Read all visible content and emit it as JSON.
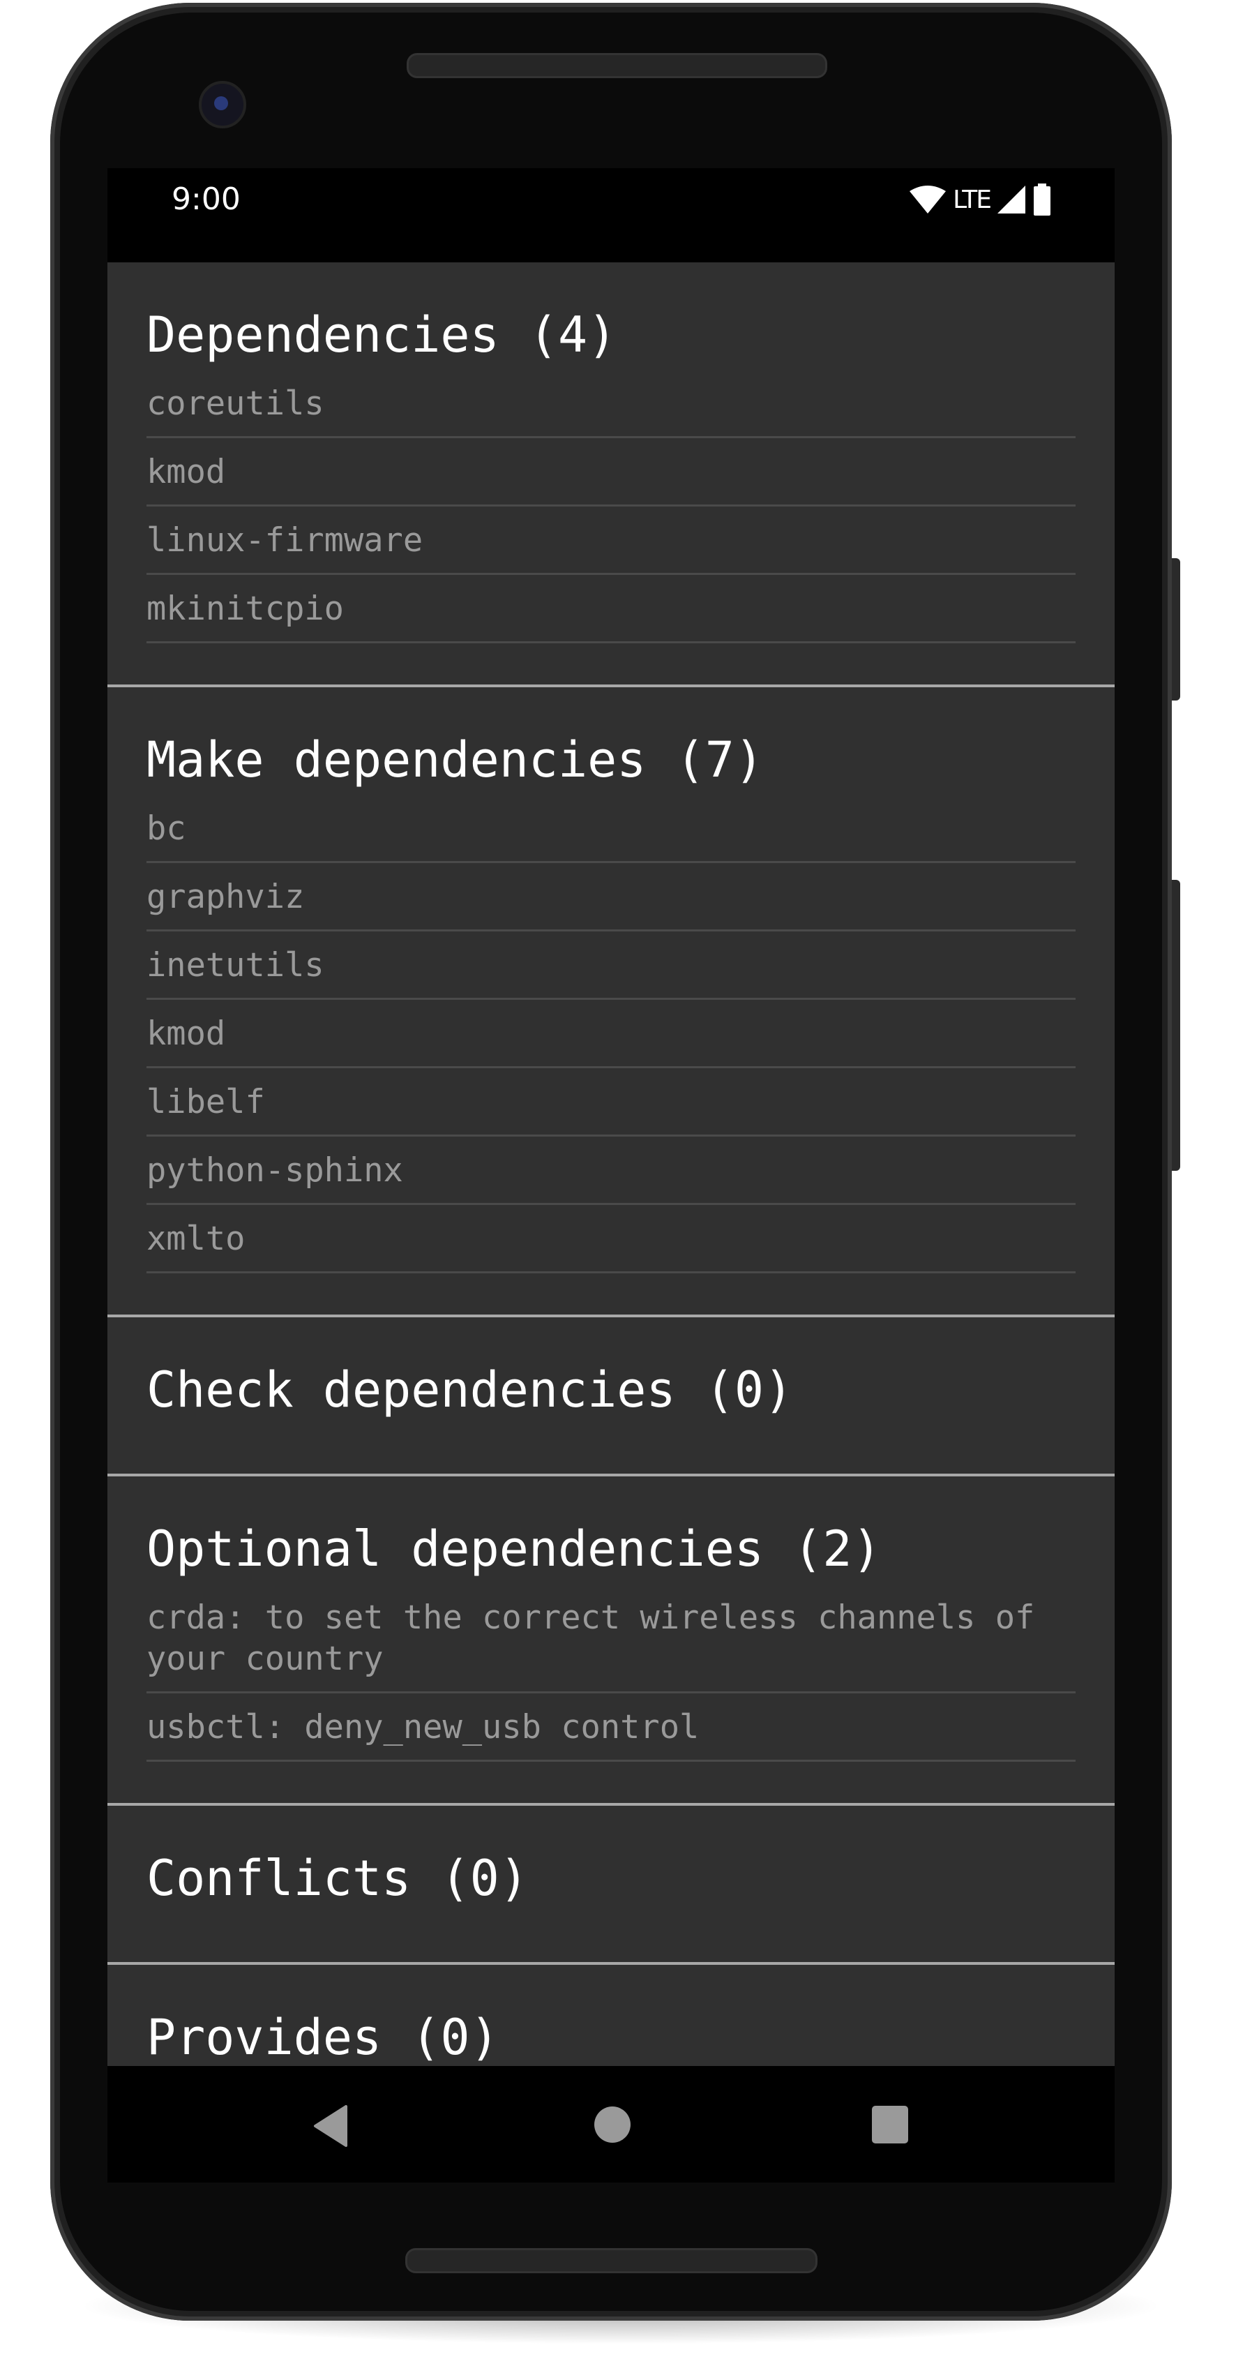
{
  "status_bar": {
    "time": "9:00",
    "network": "LTE",
    "icons": [
      "wifi-icon",
      "signal-icon",
      "battery-icon"
    ]
  },
  "sections": [
    {
      "title": "Dependencies (4)",
      "items": [
        "coreutils",
        "kmod",
        "linux-firmware",
        "mkinitcpio"
      ]
    },
    {
      "title": "Make dependencies (7)",
      "items": [
        "bc",
        "graphviz",
        "inetutils",
        "kmod",
        "libelf",
        "python-sphinx",
        "xmlto"
      ]
    },
    {
      "title": "Check dependencies (0)",
      "items": []
    },
    {
      "title": "Optional dependencies (2)",
      "items": [
        "crda: to set the correct wireless channels of your country",
        "usbctl: deny_new_usb control"
      ]
    },
    {
      "title": "Conflicts (0)",
      "items": []
    },
    {
      "title": "Provides (0)",
      "items": []
    }
  ],
  "nav_bar": {
    "buttons": [
      "back",
      "home",
      "recents"
    ]
  },
  "colors": {
    "background": "#303030",
    "title": "#ffffff",
    "item": "#9a9a9a",
    "divider": "#4a4a4a",
    "section_divider": "#a8a8a8"
  }
}
